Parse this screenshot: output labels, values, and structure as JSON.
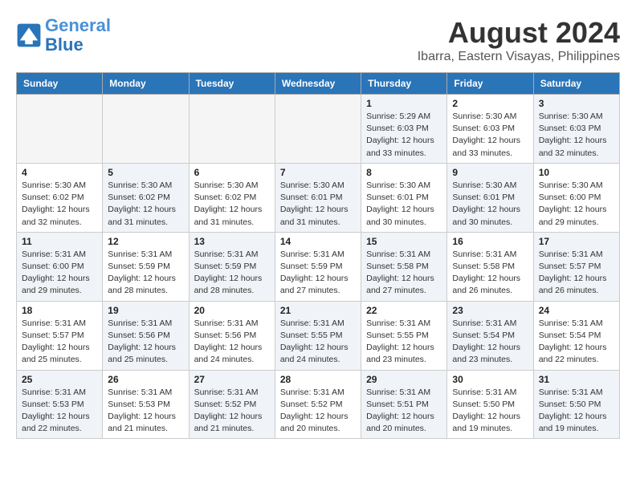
{
  "header": {
    "logo_line1": "General",
    "logo_line2": "Blue",
    "main_title": "August 2024",
    "subtitle": "Ibarra, Eastern Visayas, Philippines"
  },
  "weekdays": [
    "Sunday",
    "Monday",
    "Tuesday",
    "Wednesday",
    "Thursday",
    "Friday",
    "Saturday"
  ],
  "weeks": [
    [
      {
        "day": "",
        "info": ""
      },
      {
        "day": "",
        "info": ""
      },
      {
        "day": "",
        "info": ""
      },
      {
        "day": "",
        "info": ""
      },
      {
        "day": "1",
        "info": "Sunrise: 5:29 AM\nSunset: 6:03 PM\nDaylight: 12 hours\nand 33 minutes."
      },
      {
        "day": "2",
        "info": "Sunrise: 5:30 AM\nSunset: 6:03 PM\nDaylight: 12 hours\nand 33 minutes."
      },
      {
        "day": "3",
        "info": "Sunrise: 5:30 AM\nSunset: 6:03 PM\nDaylight: 12 hours\nand 32 minutes."
      }
    ],
    [
      {
        "day": "4",
        "info": "Sunrise: 5:30 AM\nSunset: 6:02 PM\nDaylight: 12 hours\nand 32 minutes."
      },
      {
        "day": "5",
        "info": "Sunrise: 5:30 AM\nSunset: 6:02 PM\nDaylight: 12 hours\nand 31 minutes."
      },
      {
        "day": "6",
        "info": "Sunrise: 5:30 AM\nSunset: 6:02 PM\nDaylight: 12 hours\nand 31 minutes."
      },
      {
        "day": "7",
        "info": "Sunrise: 5:30 AM\nSunset: 6:01 PM\nDaylight: 12 hours\nand 31 minutes."
      },
      {
        "day": "8",
        "info": "Sunrise: 5:30 AM\nSunset: 6:01 PM\nDaylight: 12 hours\nand 30 minutes."
      },
      {
        "day": "9",
        "info": "Sunrise: 5:30 AM\nSunset: 6:01 PM\nDaylight: 12 hours\nand 30 minutes."
      },
      {
        "day": "10",
        "info": "Sunrise: 5:30 AM\nSunset: 6:00 PM\nDaylight: 12 hours\nand 29 minutes."
      }
    ],
    [
      {
        "day": "11",
        "info": "Sunrise: 5:31 AM\nSunset: 6:00 PM\nDaylight: 12 hours\nand 29 minutes."
      },
      {
        "day": "12",
        "info": "Sunrise: 5:31 AM\nSunset: 5:59 PM\nDaylight: 12 hours\nand 28 minutes."
      },
      {
        "day": "13",
        "info": "Sunrise: 5:31 AM\nSunset: 5:59 PM\nDaylight: 12 hours\nand 28 minutes."
      },
      {
        "day": "14",
        "info": "Sunrise: 5:31 AM\nSunset: 5:59 PM\nDaylight: 12 hours\nand 27 minutes."
      },
      {
        "day": "15",
        "info": "Sunrise: 5:31 AM\nSunset: 5:58 PM\nDaylight: 12 hours\nand 27 minutes."
      },
      {
        "day": "16",
        "info": "Sunrise: 5:31 AM\nSunset: 5:58 PM\nDaylight: 12 hours\nand 26 minutes."
      },
      {
        "day": "17",
        "info": "Sunrise: 5:31 AM\nSunset: 5:57 PM\nDaylight: 12 hours\nand 26 minutes."
      }
    ],
    [
      {
        "day": "18",
        "info": "Sunrise: 5:31 AM\nSunset: 5:57 PM\nDaylight: 12 hours\nand 25 minutes."
      },
      {
        "day": "19",
        "info": "Sunrise: 5:31 AM\nSunset: 5:56 PM\nDaylight: 12 hours\nand 25 minutes."
      },
      {
        "day": "20",
        "info": "Sunrise: 5:31 AM\nSunset: 5:56 PM\nDaylight: 12 hours\nand 24 minutes."
      },
      {
        "day": "21",
        "info": "Sunrise: 5:31 AM\nSunset: 5:55 PM\nDaylight: 12 hours\nand 24 minutes."
      },
      {
        "day": "22",
        "info": "Sunrise: 5:31 AM\nSunset: 5:55 PM\nDaylight: 12 hours\nand 23 minutes."
      },
      {
        "day": "23",
        "info": "Sunrise: 5:31 AM\nSunset: 5:54 PM\nDaylight: 12 hours\nand 23 minutes."
      },
      {
        "day": "24",
        "info": "Sunrise: 5:31 AM\nSunset: 5:54 PM\nDaylight: 12 hours\nand 22 minutes."
      }
    ],
    [
      {
        "day": "25",
        "info": "Sunrise: 5:31 AM\nSunset: 5:53 PM\nDaylight: 12 hours\nand 22 minutes."
      },
      {
        "day": "26",
        "info": "Sunrise: 5:31 AM\nSunset: 5:53 PM\nDaylight: 12 hours\nand 21 minutes."
      },
      {
        "day": "27",
        "info": "Sunrise: 5:31 AM\nSunset: 5:52 PM\nDaylight: 12 hours\nand 21 minutes."
      },
      {
        "day": "28",
        "info": "Sunrise: 5:31 AM\nSunset: 5:52 PM\nDaylight: 12 hours\nand 20 minutes."
      },
      {
        "day": "29",
        "info": "Sunrise: 5:31 AM\nSunset: 5:51 PM\nDaylight: 12 hours\nand 20 minutes."
      },
      {
        "day": "30",
        "info": "Sunrise: 5:31 AM\nSunset: 5:50 PM\nDaylight: 12 hours\nand 19 minutes."
      },
      {
        "day": "31",
        "info": "Sunrise: 5:31 AM\nSunset: 5:50 PM\nDaylight: 12 hours\nand 19 minutes."
      }
    ]
  ]
}
